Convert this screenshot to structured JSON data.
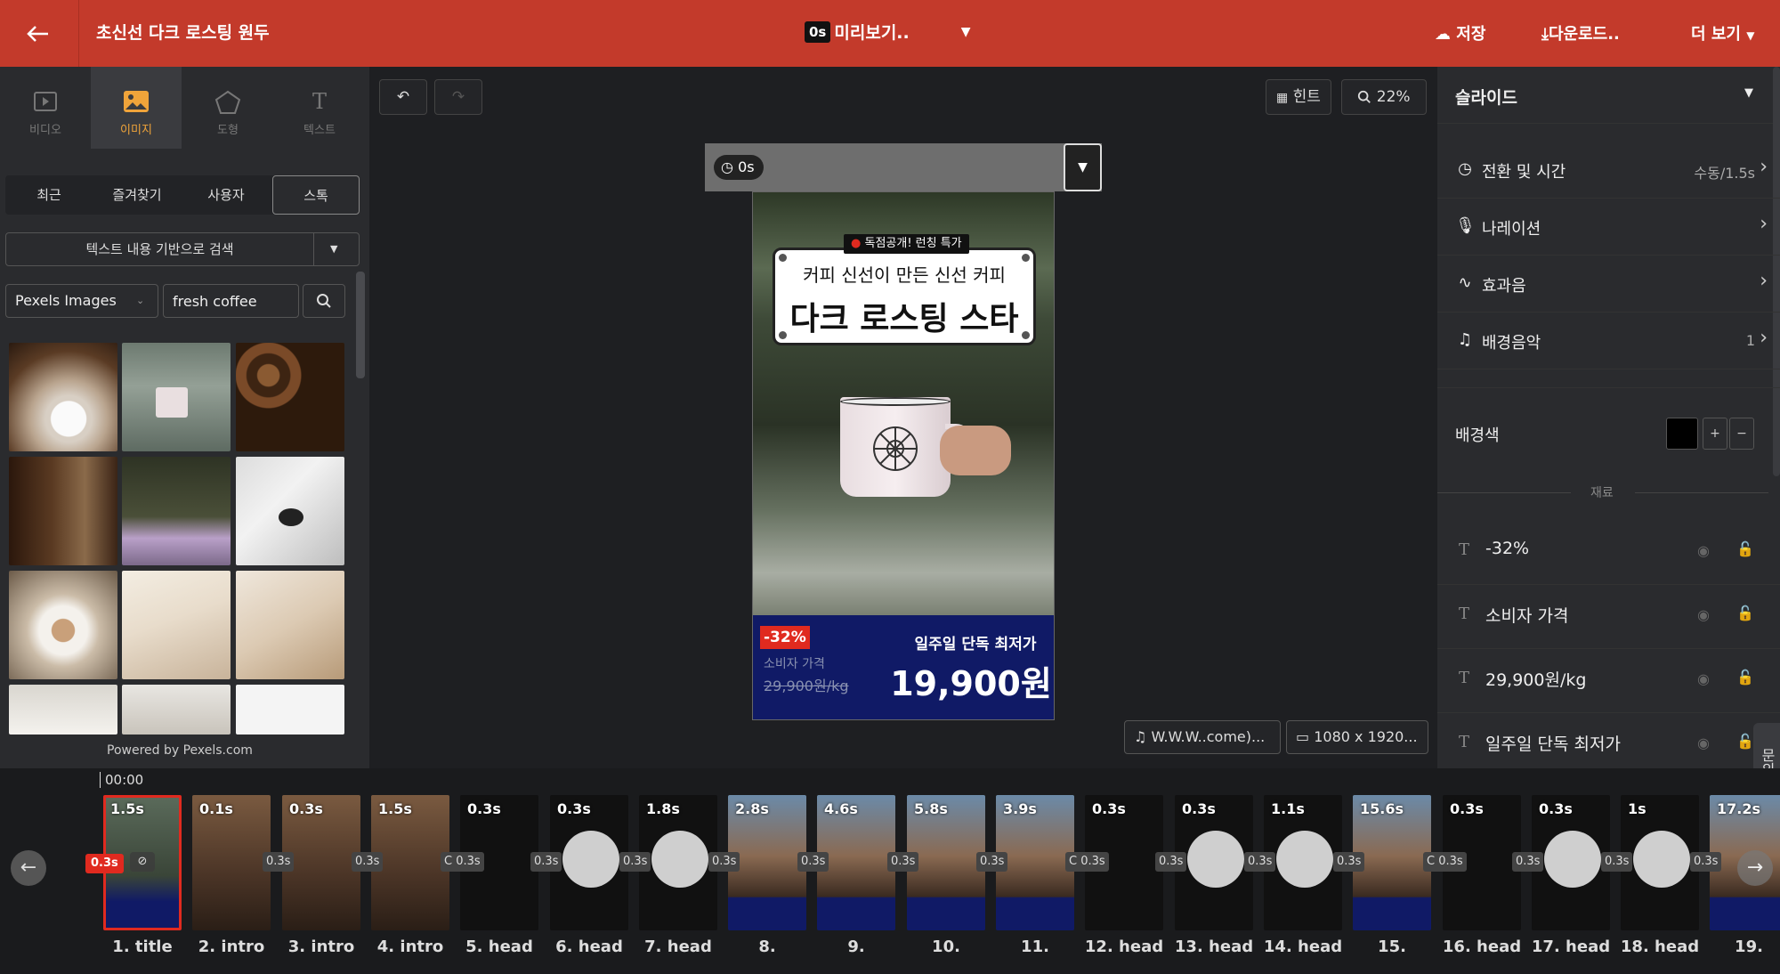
{
  "header": {
    "project_title": "초신선 다크 로스팅 원두",
    "preview_time": "0s",
    "preview_label": "미리보기..",
    "save_label": "저장",
    "download_label": "다운로드..",
    "more_label": "더 보기"
  },
  "left": {
    "tabs": [
      {
        "label": "비디오",
        "icon": "video-icon"
      },
      {
        "label": "이미지",
        "icon": "image-icon"
      },
      {
        "label": "도형",
        "icon": "pentagon-icon"
      },
      {
        "label": "텍스트",
        "icon": "text-icon"
      }
    ],
    "subtabs": [
      "최근",
      "즐겨찾기",
      "사용자",
      "스톡"
    ],
    "search_mode": "텍스트 내용 기반으로 검색",
    "source": "Pexels Images",
    "keyword": "fresh coffee",
    "powered": "Powered by Pexels.com"
  },
  "canvas": {
    "hint_label": "힌트",
    "zoom": "22%",
    "slide_time": "0s",
    "ribbon": "독점공개! 런칭 특가",
    "subtitle": "커피 신선이 만든 신선 커피",
    "headline": "다크 로스팅 스타",
    "discount": "-32%",
    "consumer_price_label": "소비자 가격",
    "consumer_price": "29,900원/kg",
    "deal_label": "일주일 단독 최저가",
    "price": "19,900원",
    "audio": "W.W.W..come)...",
    "resolution": "1080 x 1920..."
  },
  "right": {
    "panel_title": "슬라이드",
    "rows": [
      {
        "label": "전환 및 시간",
        "value": "수동/1.5s",
        "icon": "clock-icon"
      },
      {
        "label": "나레이션",
        "value": "",
        "icon": "microphone-icon"
      },
      {
        "label": "효과음",
        "value": "",
        "icon": "waveform-icon"
      },
      {
        "label": "배경음악",
        "value": "1",
        "icon": "music-note-icon"
      }
    ],
    "bg_label": "배경색",
    "bg_color": "#000000",
    "material_label": "재료",
    "layers": [
      "-32%",
      "소비자 가격",
      "29,900원/kg",
      "일주일 단독 최저가"
    ],
    "help": "문의"
  },
  "timeline": {
    "time": "00:00",
    "selected_transition": "0.3s",
    "clips": [
      {
        "dur": "1.5s",
        "name": "1. title"
      },
      {
        "dur": "0.1s",
        "name": "2. intro"
      },
      {
        "dur": "0.3s",
        "name": "3. intro"
      },
      {
        "dur": "1.5s",
        "name": "4. intro"
      },
      {
        "dur": "0.3s",
        "name": "5. head"
      },
      {
        "dur": "0.3s",
        "name": "6. head"
      },
      {
        "dur": "1.8s",
        "name": "7. head"
      },
      {
        "dur": "2.8s",
        "name": "8."
      },
      {
        "dur": "4.6s",
        "name": "9."
      },
      {
        "dur": "5.8s",
        "name": "10."
      },
      {
        "dur": "3.9s",
        "name": "11."
      },
      {
        "dur": "0.3s",
        "name": "12. head"
      },
      {
        "dur": "0.3s",
        "name": "13. head"
      },
      {
        "dur": "1.1s",
        "name": "14. head"
      },
      {
        "dur": "15.6s",
        "name": "15."
      },
      {
        "dur": "0.3s",
        "name": "16. head"
      },
      {
        "dur": "0.3s",
        "name": "17. head"
      },
      {
        "dur": "1s",
        "name": "18. head"
      },
      {
        "dur": "17.2s",
        "name": "19."
      }
    ],
    "transitions": [
      "0.3s",
      "0.3s",
      "C 0.3s",
      "0.3s",
      "0.3s",
      "0.3s",
      "0.3s",
      "0.3s",
      "0.3s",
      "C 0.3s",
      "0.3s",
      "0.3s",
      "0.3s",
      "C 0.3s",
      "0.3s",
      "0.3s",
      "0.3s"
    ]
  },
  "colors": {
    "brand": "#c33a2b",
    "accent": "#f0a43a",
    "price_bg": "#101a66",
    "discount": "#e02a1f"
  }
}
